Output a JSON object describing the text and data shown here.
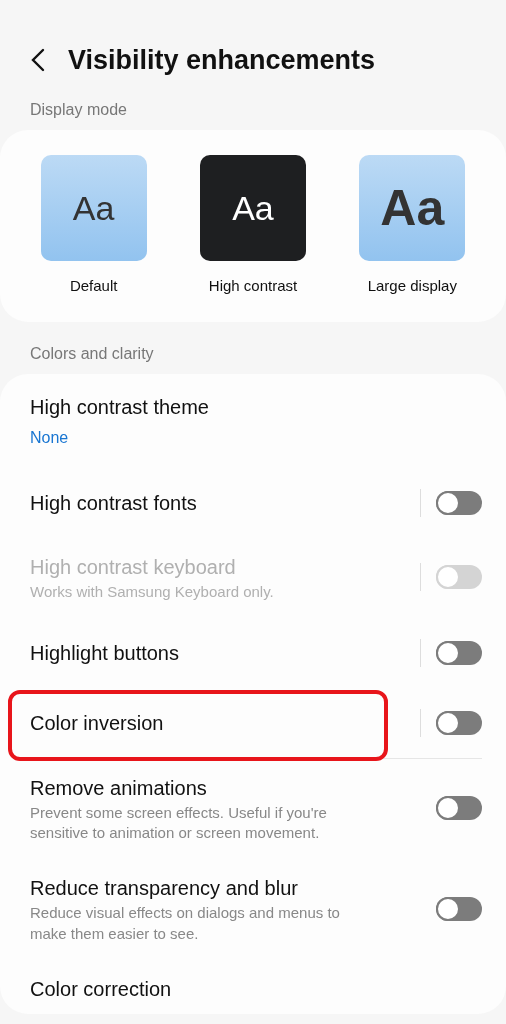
{
  "header": {
    "title": "Visibility enhancements"
  },
  "display_mode": {
    "label": "Display mode",
    "options": [
      {
        "sample": "Aa",
        "label": "Default",
        "kind": "default"
      },
      {
        "sample": "Aa",
        "label": "High contrast",
        "kind": "contrast"
      },
      {
        "sample": "Aa",
        "label": "Large display",
        "kind": "large"
      }
    ]
  },
  "colors_and_clarity": {
    "label": "Colors and clarity",
    "items": [
      {
        "kind": "value",
        "title": "High contrast theme",
        "value": "None",
        "disabled": false,
        "highlighted": false
      },
      {
        "kind": "switch",
        "title": "High contrast fonts",
        "on": false,
        "disabled": false,
        "separator": true,
        "highlighted": false
      },
      {
        "kind": "switch",
        "title": "High contrast keyboard",
        "subtitle": "Works with Samsung Keyboard only.",
        "on": false,
        "disabled": true,
        "separator": true,
        "highlighted": false
      },
      {
        "kind": "switch",
        "title": "Highlight buttons",
        "on": false,
        "disabled": false,
        "separator": true,
        "highlighted": false
      },
      {
        "kind": "switch",
        "title": "Color inversion",
        "on": false,
        "disabled": false,
        "separator": true,
        "highlighted": true
      },
      {
        "kind": "switch",
        "title": "Remove animations",
        "subtitle": "Prevent some screen effects. Useful if you're sensitive to animation or screen movement.",
        "on": false,
        "disabled": false,
        "separator": false,
        "highlighted": false
      },
      {
        "kind": "switch",
        "title": "Reduce transparency and blur",
        "subtitle": "Reduce visual effects on dialogs and menus to make them easier to see.",
        "on": false,
        "disabled": false,
        "separator": false,
        "highlighted": false
      },
      {
        "kind": "plain",
        "title": "Color correction",
        "disabled": false,
        "highlighted": false
      }
    ]
  }
}
